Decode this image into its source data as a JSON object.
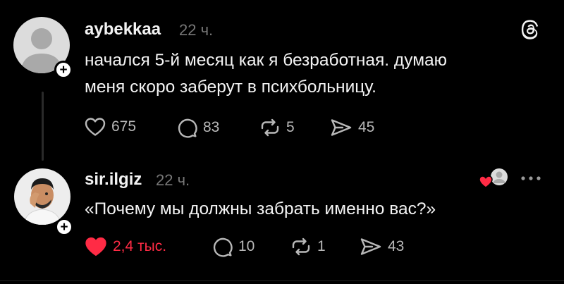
{
  "posts": [
    {
      "username": "aybekkaa",
      "time": "22 ч.",
      "text_lines": [
        "начался 5-й месяц как я безработная. думаю",
        "меня скоро заберут в психбольницу."
      ],
      "likes": "675",
      "replies": "83",
      "reposts": "5",
      "shares": "45",
      "liked": false
    },
    {
      "username": "sir.ilgiz",
      "time": "22 ч.",
      "text_lines": [
        "«Почему мы должны забрать именно вас?»"
      ],
      "likes": "2,4 тыс.",
      "replies": "10",
      "reposts": "1",
      "shares": "43",
      "liked": true
    }
  ],
  "colors": {
    "background": "#000000",
    "text": "#f3f3f3",
    "muted": "#777777",
    "like_active": "#ff2b45"
  },
  "icons": {
    "header": "threads-logo-icon",
    "more": "more-dots-icon",
    "liked_by_author": "heart-avatar-icon"
  }
}
